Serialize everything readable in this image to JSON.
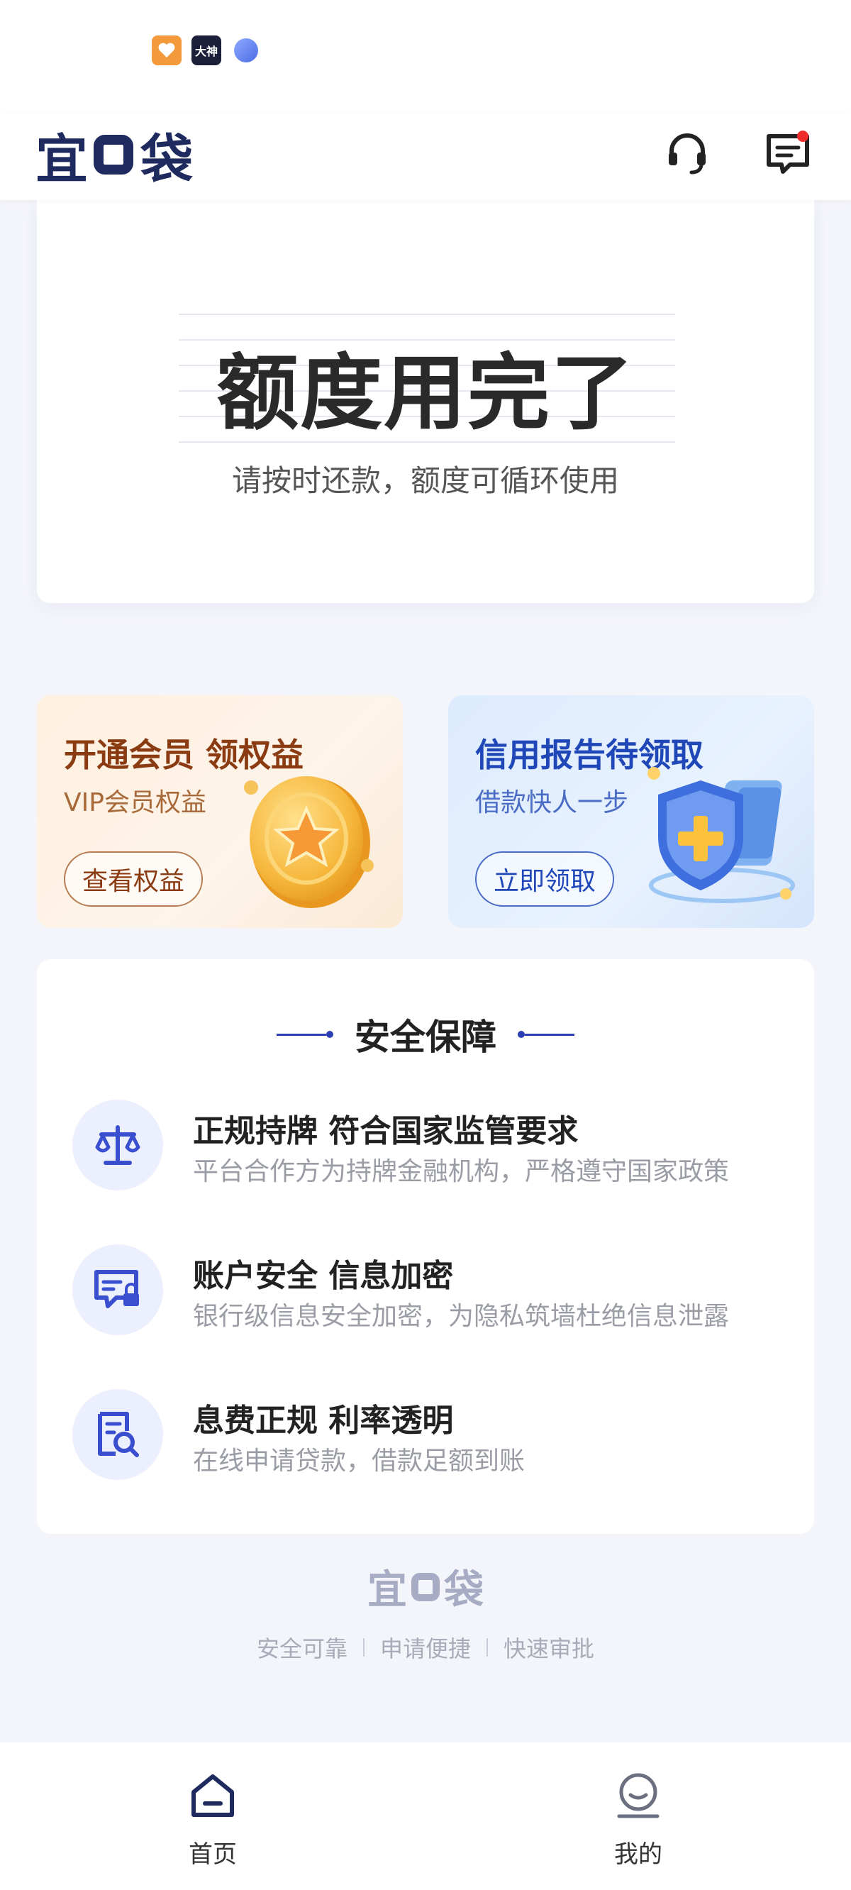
{
  "status_bar": {
    "icons": [
      "health-app-icon",
      "dashen-app-icon",
      "browser-app-icon"
    ],
    "dashen_label": "大神"
  },
  "header": {
    "logo_text_left": "宜",
    "logo_text_right": "袋",
    "icons": [
      "customer-service-icon",
      "message-icon"
    ],
    "has_unread": true
  },
  "quota": {
    "title": "额度用完了",
    "subtitle": "请按时还款，额度可循环使用"
  },
  "promos": {
    "vip": {
      "title": "开通会员 领权益",
      "subtitle": "VIP会员权益",
      "button": "查看权益",
      "art": "gold-star-coin-icon"
    },
    "credit": {
      "title": "信用报告待领取",
      "subtitle": "借款快人一步",
      "button": "立即领取",
      "art": "shield-plus-icon"
    }
  },
  "safety": {
    "title": "安全保障",
    "features": [
      {
        "icon": "scale-icon",
        "title": "正规持牌 符合国家监管要求",
        "desc": "平台合作方为持牌金融机构，严格遵守国家政策"
      },
      {
        "icon": "secure-message-icon",
        "title": "账户安全 信息加密",
        "desc": "银行级信息安全加密，为隐私筑墙杜绝信息泄露"
      },
      {
        "icon": "document-search-icon",
        "title": "息费正规  利率透明",
        "desc": "在线申请贷款，借款足额到账"
      }
    ]
  },
  "footer": {
    "logo_text_left": "宜",
    "logo_text_right": "袋",
    "tags": [
      "安全可靠",
      "申请便捷",
      "快速审批"
    ]
  },
  "tabbar": {
    "home": "首页",
    "mine": "我的"
  },
  "colors": {
    "brand": "#1f2a5e",
    "accent": "#2b3fb3",
    "alert": "#f02b2b"
  }
}
